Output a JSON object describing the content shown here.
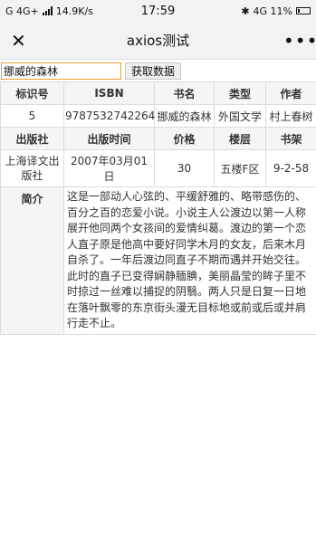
{
  "status": {
    "left": "G 4G+",
    "speed": "14.9K/s",
    "time": "17:59",
    "right": "4G 11%"
  },
  "titlebar": {
    "close": "✕",
    "title": "axios测试",
    "more": "•••"
  },
  "search": {
    "value": "挪威的森林",
    "button": "获取数据"
  },
  "table": {
    "h1": [
      "标识号",
      "ISBN",
      "书名",
      "类型",
      "作者"
    ],
    "r1": [
      "5",
      "9787532742264",
      "挪威的森林",
      "外国文学",
      "村上春树"
    ],
    "h2": [
      "出版社",
      "出版时间",
      "价格",
      "楼层",
      "书架"
    ],
    "r2": [
      "上海译文出版社",
      "2007年03月01日",
      "30",
      "五楼F区",
      "9-2-58"
    ],
    "desc_label": "简介",
    "desc": "这是一部动人心弦的、平缓舒雅的、略带感伤的、百分之百的恋爱小说。小说主人公渡边以第一人称展开他同两个女孩间的爱情纠葛。渡边的第一个恋人直子原是他高中要好同学木月的女友，后来木月自杀了。一年后渡边同直子不期而遇并开始交往。此时的直子已变得娴静腼腆，美丽晶莹的眸子里不时掠过一丝难以捕捉的阴翳。两人只是日复一日地在落叶飘零的东京街头漫无目标地或前或后或并肩行走不止。"
  }
}
